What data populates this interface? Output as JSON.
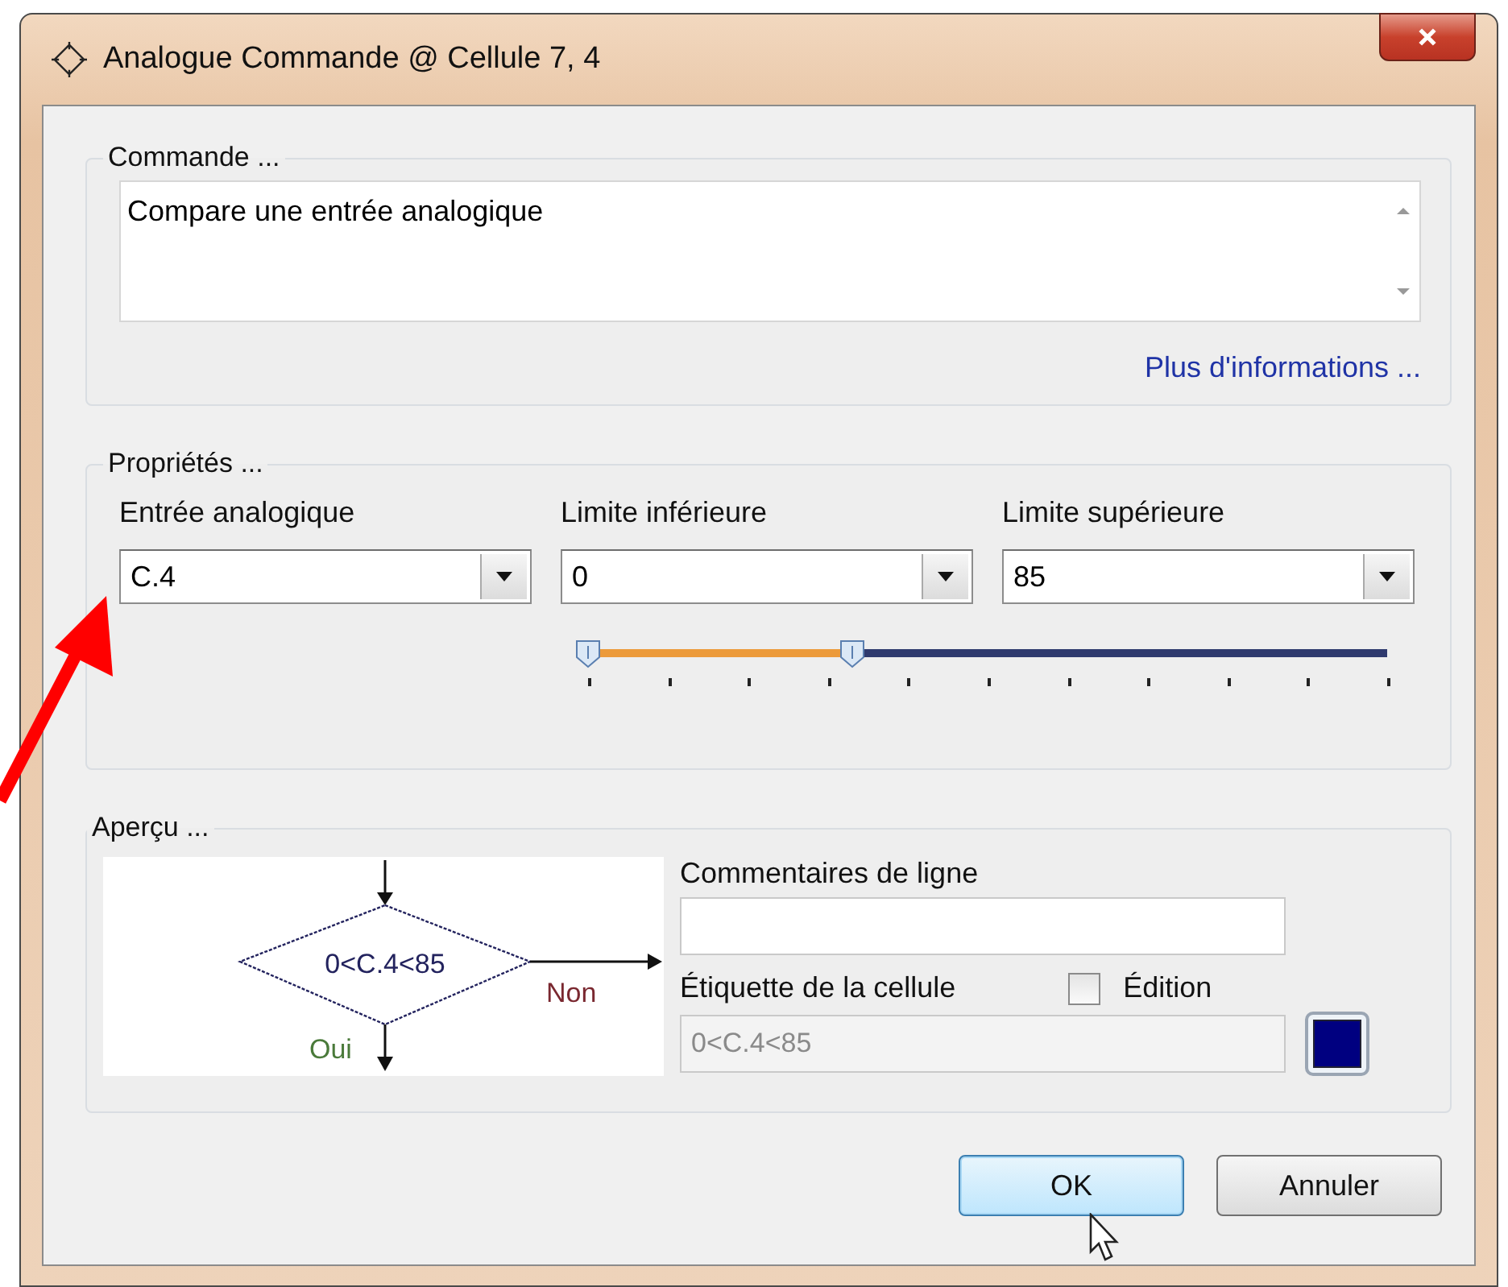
{
  "window": {
    "title": "Analogue Commande @ Cellule 7, 4"
  },
  "command": {
    "legend": "Commande ...",
    "description": "Compare une entrée analogique",
    "link": "Plus d'informations ..."
  },
  "properties": {
    "legend": "Propriétés ...",
    "fields": [
      {
        "label": "Entrée analogique",
        "value": "C.4"
      },
      {
        "label": "Limite inférieure",
        "value": "0"
      },
      {
        "label": "Limite supérieure",
        "value": "85"
      }
    ],
    "slider": {
      "thumbs": [
        {
          "level": 0
        },
        {
          "level": 0.33
        }
      ]
    }
  },
  "preview": {
    "legend": "Aperçu ...",
    "condition": "0<C.4<85",
    "no_label": "Non",
    "yes_label": "Oui",
    "comment_label": "Commentaires de ligne",
    "cell_label": "Étiquette de la cellule",
    "edit": {
      "label": "Édition",
      "checked": false
    },
    "cell_value": "0<C.4<85",
    "color": "#000080"
  },
  "buttons": [
    {
      "label": "OK",
      "default": true
    },
    {
      "label": "Annuler",
      "default": false
    }
  ]
}
